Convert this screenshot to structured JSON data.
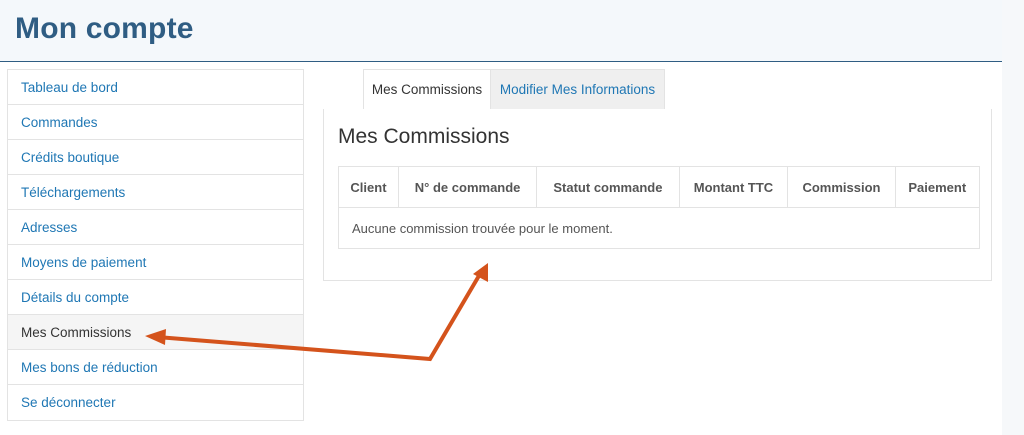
{
  "page": {
    "title": "Mon compte"
  },
  "sidebar": {
    "items": [
      {
        "label": "Tableau de bord"
      },
      {
        "label": "Commandes"
      },
      {
        "label": "Crédits boutique"
      },
      {
        "label": "Téléchargements"
      },
      {
        "label": "Adresses"
      },
      {
        "label": "Moyens de paiement"
      },
      {
        "label": "Détails du compte"
      },
      {
        "label": "Mes Commissions"
      },
      {
        "label": "Mes bons de réduction"
      },
      {
        "label": "Se déconnecter"
      }
    ],
    "active_index": 7
  },
  "tabs": [
    {
      "label": "Mes Commissions"
    },
    {
      "label": "Modifier Mes Informations"
    }
  ],
  "panel": {
    "title": "Mes Commissions",
    "table": {
      "columns": [
        "Client",
        "N° de commande",
        "Statut commande",
        "Montant TTC",
        "Commission",
        "Paiement"
      ],
      "empty_message": "Aucune commission trouvée pour le moment."
    }
  },
  "colors": {
    "title": "#2f5d83",
    "link": "#1f77b4",
    "annotation_arrow": "#d4531c"
  }
}
